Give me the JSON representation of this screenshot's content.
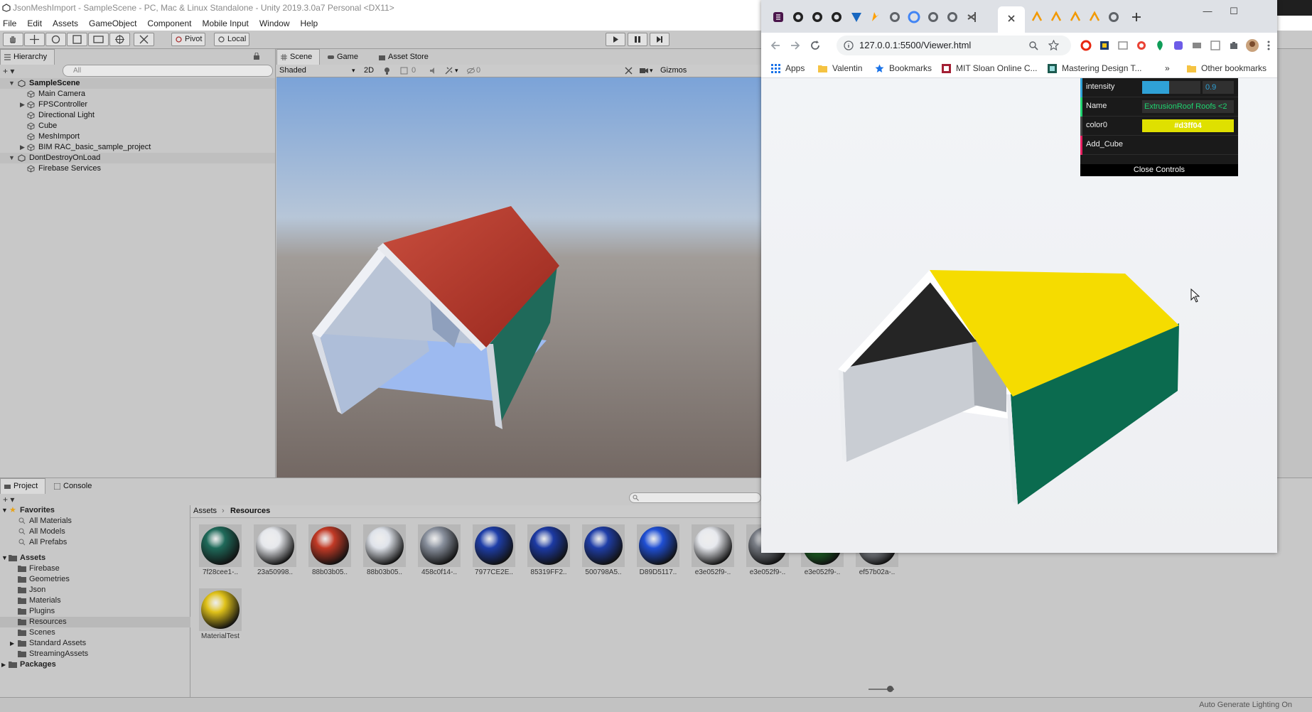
{
  "unity": {
    "title": "JsonMeshImport - SampleScene - PC, Mac & Linux Standalone - Unity 2019.3.0a7 Personal <DX11>",
    "menu": [
      "File",
      "Edit",
      "Assets",
      "GameObject",
      "Component",
      "Mobile Input",
      "Window",
      "Help"
    ],
    "toolbar": {
      "pivot_label": "Pivot",
      "local_label": "Local"
    },
    "hierarchy": {
      "tab_label": "Hierarchy",
      "search_placeholder": "All",
      "scene1": "SampleScene",
      "items1": [
        "Main Camera",
        "FPSController",
        "Directional Light",
        "Cube",
        "MeshImport",
        "BIM RAC_basic_sample_project"
      ],
      "scene2": "DontDestroyOnLoad",
      "items2": [
        "Firebase Services"
      ]
    },
    "scene": {
      "tabs": [
        "Scene",
        "Game",
        "Asset Store"
      ],
      "shading_mode": "Shaded",
      "mode_2d": "2D",
      "light_count": "0",
      "effects_count": "0",
      "gizmos_label": "Gizmos",
      "roof_color": "#b33a2d",
      "wall_color": "#1f6a5a"
    },
    "project": {
      "tabs": [
        "Project",
        "Console"
      ],
      "favorites_label": "Favorites",
      "favorites": [
        "All Materials",
        "All Models",
        "All Prefabs"
      ],
      "assets_label": "Assets",
      "asset_folders": [
        "Firebase",
        "Geometries",
        "Json",
        "Materials",
        "Plugins",
        "Resources",
        "Scenes",
        "Standard Assets",
        "StreamingAssets"
      ],
      "packages_label": "Packages",
      "breadcrumb": [
        "Assets",
        "Resources"
      ],
      "materials": [
        {
          "label": "7f28cee1-..",
          "color": "#1f6a5a"
        },
        {
          "label": "23a50998..",
          "color": "#e6e8ec"
        },
        {
          "label": "88b03b05..",
          "color": "#c23a26"
        },
        {
          "label": "88b03b05..",
          "color": "#dfe3ea"
        },
        {
          "label": "458c0f14-..",
          "color": "#8a919e"
        },
        {
          "label": "7977CE2E..",
          "color": "#1e3ea8"
        },
        {
          "label": "85319FF2..",
          "color": "#1c3aa4"
        },
        {
          "label": "500798A5..",
          "color": "#1f3ea8"
        },
        {
          "label": "D89D5117..",
          "color": "#1f4fd4"
        },
        {
          "label": "e3e052f9-..",
          "color": "#e7e9ee"
        },
        {
          "label": "e3e052f9-..",
          "color": "#7b7f87"
        },
        {
          "label": "e3e052f9-..",
          "color": "#1f7a2a"
        },
        {
          "label": "ef57b02a-..",
          "color": "#9fa4ad"
        },
        {
          "label": "MaterialTest",
          "color": "#e0c21a"
        }
      ]
    },
    "status": "Auto Generate Lighting On"
  },
  "browser": {
    "url": "127.0.0.1:5500/Viewer.html",
    "bookmarks": [
      "Apps",
      "Valentin",
      "Bookmarks",
      "MIT Sloan Online C...",
      "Mastering Design T...",
      "Other bookmarks"
    ],
    "more_bookmarks": "»",
    "gui": {
      "intensity_label": "intensity",
      "intensity_value": "0.9",
      "name_label": "Name",
      "name_value": "ExtrusionRoof Roofs <2",
      "color_label": "color0",
      "color_value": "#d3ff04",
      "add_cube_label": "Add_Cube",
      "close_label": "Close Controls"
    },
    "model": {
      "roof_color": "#f5dc00",
      "wall_color": "#0b6b4f",
      "gable_color": "#242424"
    }
  }
}
